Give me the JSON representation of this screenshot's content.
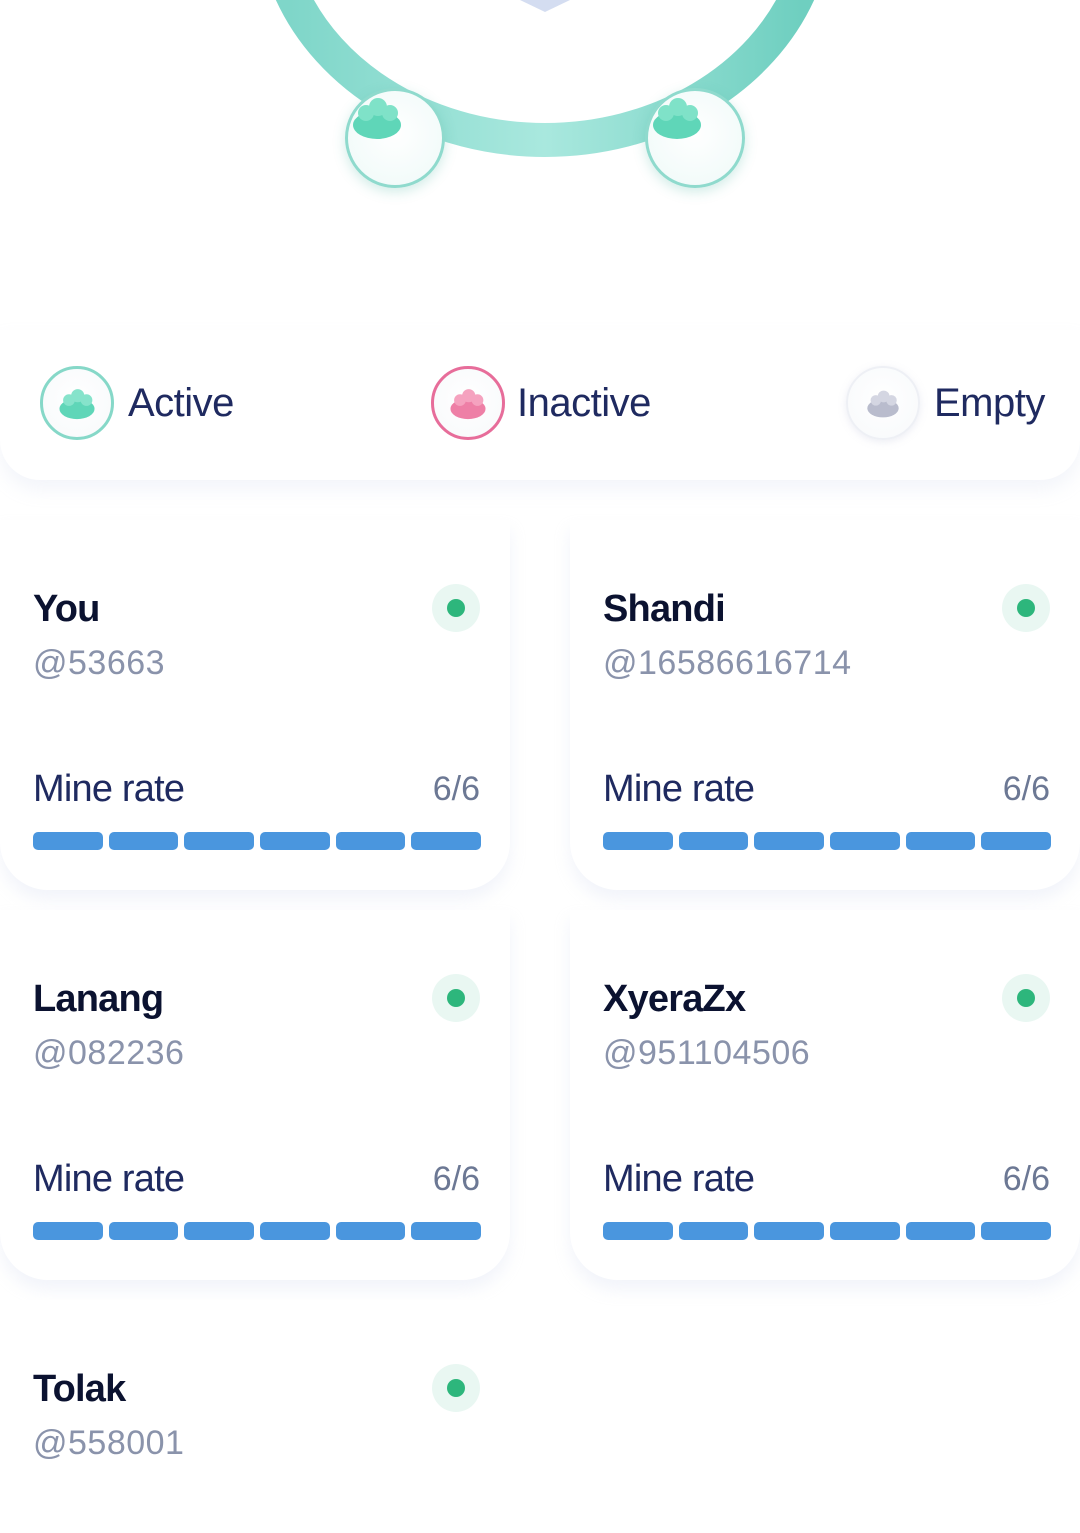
{
  "colors": {
    "active": "#86d8c8",
    "inactive": "#e76d9a",
    "empty": "#c7cad6",
    "bar_fill": "#4a96de",
    "status_online": "#2db67c"
  },
  "legend": [
    {
      "label": "Active",
      "icon": "active-member-icon"
    },
    {
      "label": "Inactive",
      "icon": "inactive-member-icon"
    },
    {
      "label": "Empty",
      "icon": "empty-slot-icon"
    }
  ],
  "members": [
    {
      "name": "You",
      "handle": "@53663",
      "rate_label": "Mine rate",
      "rate": "6/6",
      "filled": 6,
      "total": 6,
      "status": "online"
    },
    {
      "name": "Shandi",
      "handle": "@16586616714",
      "rate_label": "Mine rate",
      "rate": "6/6",
      "filled": 6,
      "total": 6,
      "status": "online"
    },
    {
      "name": "Lanang",
      "handle": "@082236",
      "rate_label": "Mine rate",
      "rate": "6/6",
      "filled": 6,
      "total": 6,
      "status": "online"
    },
    {
      "name": "XyeraZx",
      "handle": "@951104506",
      "rate_label": "Mine rate",
      "rate": "6/6",
      "filled": 6,
      "total": 6,
      "status": "online"
    },
    {
      "name": "Tolak",
      "handle": "@558001",
      "status": "online"
    }
  ]
}
